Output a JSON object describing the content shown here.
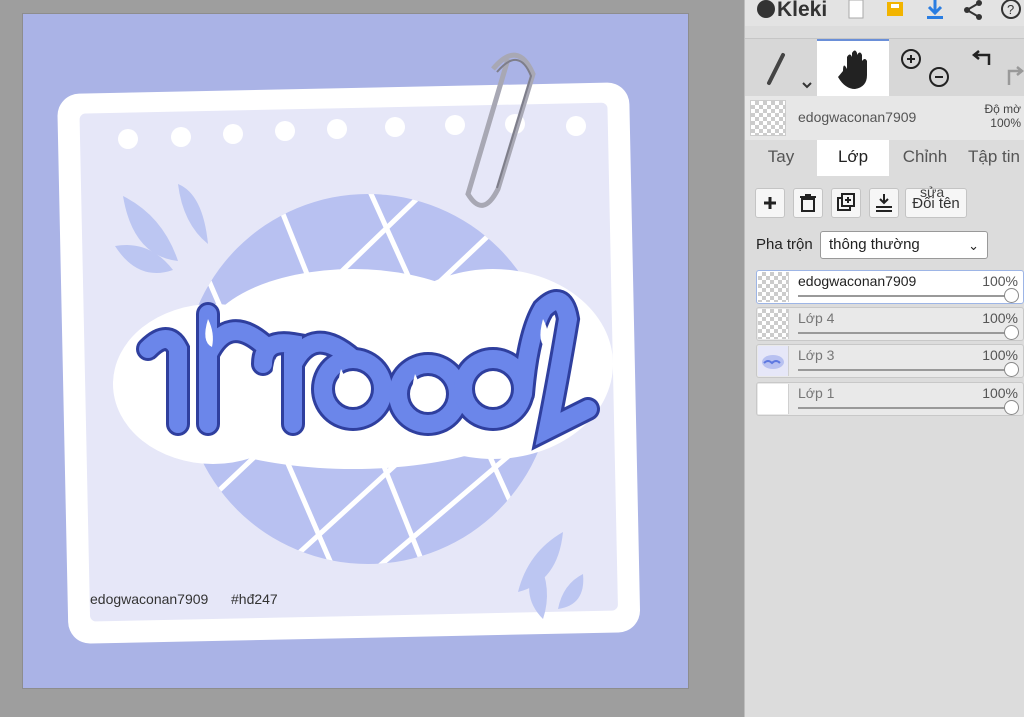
{
  "app": {
    "name": "Kleki"
  },
  "toolbar": {
    "icons": [
      "new-file-icon",
      "save-icon",
      "download-icon",
      "share-icon",
      "help-icon"
    ],
    "accent_color": "#2a7de1",
    "save_color": "#f2b400"
  },
  "tools": {
    "items": [
      "brush-tool",
      "hand-tool",
      "zoom-in",
      "zoom-out",
      "undo",
      "redo"
    ],
    "active": "hand-tool"
  },
  "current_layer": {
    "name": "edogwaconan7909",
    "opacity_label": "Độ mờ",
    "opacity_value": "100%"
  },
  "tabs": [
    {
      "label": "Tay"
    },
    {
      "label": "Lớp"
    },
    {
      "label": "Chỉnh"
    },
    {
      "label": "Tập tin"
    }
  ],
  "active_tab": "Lớp",
  "layer_actions": {
    "rename_label": "Đổi tên",
    "rename_tooltip": "sửa"
  },
  "blend": {
    "label": "Pha trộn",
    "value": "thông thường"
  },
  "layers": [
    {
      "name": "edogwaconan7909",
      "opacity": "100%",
      "active": true
    },
    {
      "name": "Lớp 4",
      "opacity": "100%",
      "active": false
    },
    {
      "name": "Lớp 3",
      "opacity": "100%",
      "active": false
    },
    {
      "name": "Lớp 1",
      "opacity": "100%",
      "active": false
    }
  ],
  "artwork": {
    "lettering": "mood",
    "caption_user": "edogwaconan7909",
    "caption_tag": "#hđ247",
    "colors": {
      "background": "#aab3e6",
      "paper": "#e6e7f8",
      "circle": "#b7c0f0",
      "letter": "#5d78e0"
    }
  }
}
